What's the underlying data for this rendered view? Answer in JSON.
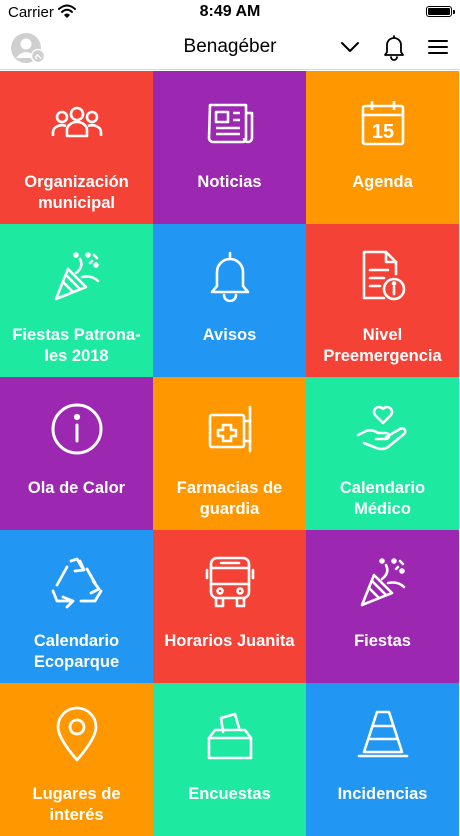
{
  "status_bar": {
    "carrier": "Carrier",
    "time": "8:49 AM"
  },
  "header": {
    "title": "Benagéber"
  },
  "tiles": [
    {
      "label": "Organización\nmunicipal",
      "color": "#f44336",
      "icon": "group-icon"
    },
    {
      "label": "Noticias",
      "color": "#9c27b0",
      "icon": "newspaper-icon"
    },
    {
      "label": "Agenda",
      "color": "#ff9800",
      "icon": "calendar-icon",
      "icon_text": "15"
    },
    {
      "label": "Fiestas Patrona-\nles 2018",
      "color": "#1de9a0",
      "icon": "party-popper-icon"
    },
    {
      "label": "Avisos",
      "color": "#2196f3",
      "icon": "bell-icon"
    },
    {
      "label": "Nivel\nPreemergencia",
      "color": "#f44336",
      "icon": "document-info-icon"
    },
    {
      "label": "Ola de Calor",
      "color": "#9c27b0",
      "icon": "info-circle-icon"
    },
    {
      "label": "Farmacias de\nguardia",
      "color": "#ff9800",
      "icon": "pharmacy-sign-icon"
    },
    {
      "label": "Calendario\nMédico",
      "color": "#1de9a0",
      "icon": "heart-hand-icon"
    },
    {
      "label": "Calendario\nEcoparque",
      "color": "#2196f3",
      "icon": "recycle-icon"
    },
    {
      "label": "Horarios Juanita",
      "color": "#f44336",
      "icon": "bus-icon"
    },
    {
      "label": "Fiestas",
      "color": "#9c27b0",
      "icon": "party-popper-icon"
    },
    {
      "label": "Lugares de\ninterés",
      "color": "#ff9800",
      "icon": "location-pin-icon"
    },
    {
      "label": "Encuestas",
      "color": "#1de9a0",
      "icon": "ballot-box-icon"
    },
    {
      "label": "Incidencias",
      "color": "#2196f3",
      "icon": "traffic-cone-icon"
    }
  ]
}
